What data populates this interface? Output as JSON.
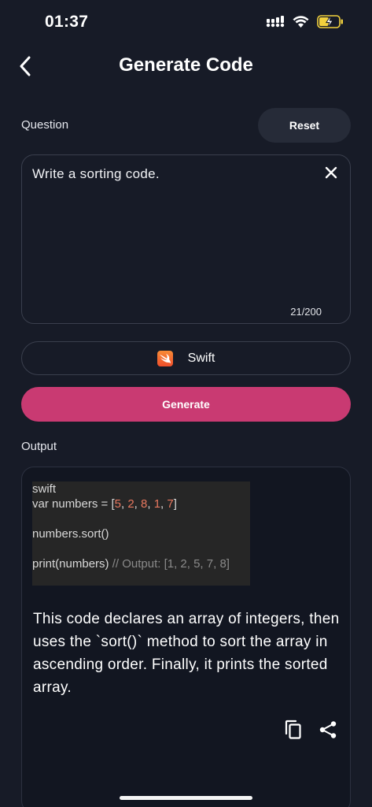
{
  "status_bar": {
    "time": "01:37"
  },
  "header": {
    "title": "Generate Code",
    "back_icon": "chevron-left-icon"
  },
  "question": {
    "label": "Question",
    "reset_label": "Reset",
    "text": "Write a sorting code.",
    "counter": "21/200",
    "clear_icon": "close-icon"
  },
  "language": {
    "name": "Swift",
    "icon": "swift-logo-icon"
  },
  "generate": {
    "label": "Generate"
  },
  "output": {
    "label": "Output",
    "code_lines": [
      "swift",
      "var numbers = [5, 2, 8, 1, 7]",
      "",
      "numbers.sort()",
      "",
      "print(numbers) // Output: [1, 2, 5, 7, 8]"
    ],
    "explanation": "This code declares an array of integers, then uses the `sort()` method to sort the array in ascending order. Finally, it prints the sorted array.",
    "actions": [
      "copy-icon",
      "share-icon"
    ]
  },
  "colors": {
    "background": "#171b27",
    "accent": "#c93a72",
    "card": "#121621"
  }
}
